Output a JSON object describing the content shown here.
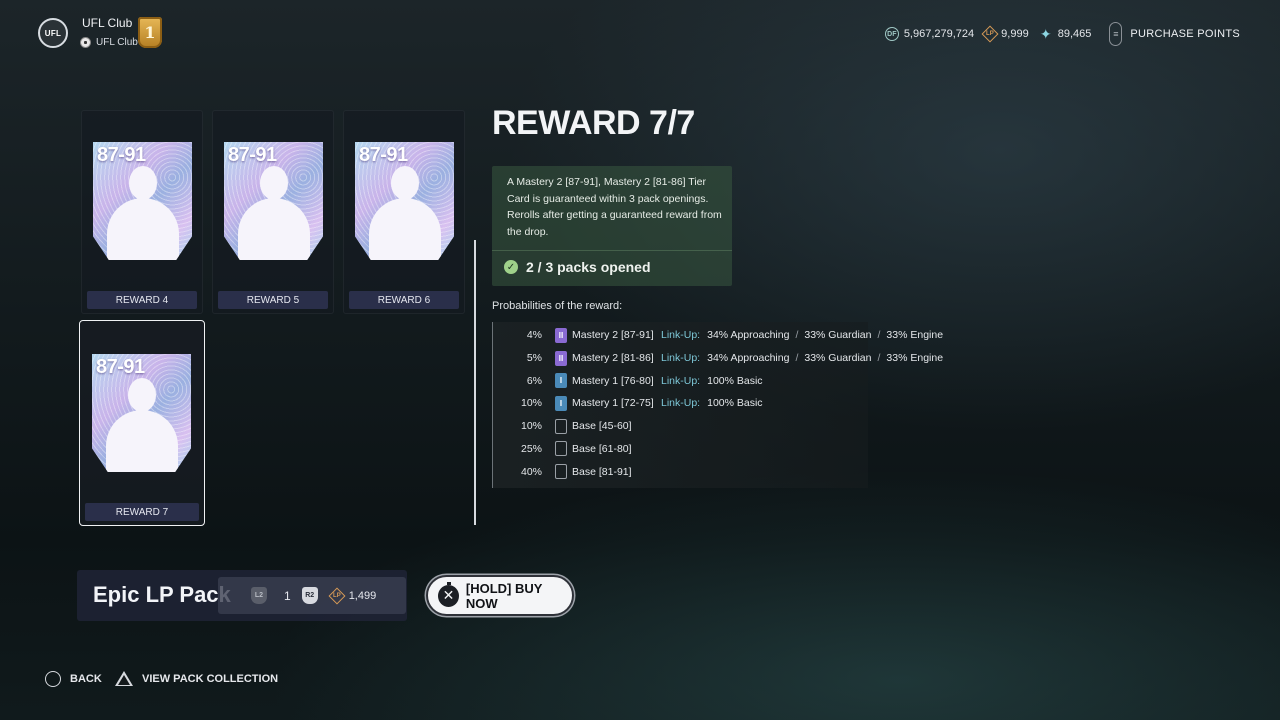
{
  "header": {
    "club_logo_text": "UFL",
    "club_name": "UFL Club",
    "club_sub": "UFL Club",
    "rank": "1",
    "currencies": [
      {
        "icon": "df-coin-icon",
        "label": "DF",
        "value": "5,967,279,724"
      },
      {
        "icon": "lp-diamond-icon",
        "label": "LP",
        "value": "9,999"
      },
      {
        "icon": "sparkle-icon",
        "label": "",
        "value": "89,465"
      }
    ],
    "purchase_points_label": "PURCHASE POINTS"
  },
  "rewards": [
    {
      "rating": "87-91",
      "label": "REWARD 4"
    },
    {
      "rating": "87-91",
      "label": "REWARD 5"
    },
    {
      "rating": "87-91",
      "label": "REWARD 6"
    },
    {
      "rating": "87-91",
      "label": "REWARD 7",
      "selected": true
    }
  ],
  "detail": {
    "title": "REWARD 7/7",
    "description": "A Mastery 2 [87-91], Mastery 2 [81-86] Tier Card is guaranteed within 3 pack openings. Rerolls after getting a guaranteed reward from the drop.",
    "packs_opened": "2 / 3 packs opened",
    "prob_heading": "Probabilities of the reward:",
    "linkup_label": "Link-Up:",
    "probabilities": [
      {
        "pct": "4%",
        "tier": "m2",
        "tier_glyph": "II",
        "name": "Mastery 2 [87-91]",
        "linkups": [
          "34% Approaching",
          "33% Guardian",
          "33% Engine"
        ]
      },
      {
        "pct": "5%",
        "tier": "m2",
        "tier_glyph": "II",
        "name": "Mastery 2 [81-86]",
        "linkups": [
          "34% Approaching",
          "33% Guardian",
          "33% Engine"
        ]
      },
      {
        "pct": "6%",
        "tier": "m1",
        "tier_glyph": "I",
        "name": "Mastery 1 [76-80]",
        "linkups": [
          "100% Basic"
        ]
      },
      {
        "pct": "10%",
        "tier": "m1",
        "tier_glyph": "I",
        "name": "Mastery 1 [72-75]",
        "linkups": [
          "100% Basic"
        ]
      },
      {
        "pct": "10%",
        "tier": "base",
        "tier_glyph": "",
        "name": "Base [45-60]",
        "linkups": []
      },
      {
        "pct": "25%",
        "tier": "base",
        "tier_glyph": "",
        "name": "Base [61-80]",
        "linkups": []
      },
      {
        "pct": "40%",
        "tier": "base",
        "tier_glyph": "",
        "name": "Base [81-91]",
        "linkups": []
      }
    ]
  },
  "pack": {
    "name": "Epic LP Pack",
    "l2_label": "L2",
    "quantity": "1",
    "r2_label": "R2",
    "lp_label": "LP",
    "price": "1,499"
  },
  "buy_button": "[HOLD] BUY NOW",
  "footer": {
    "back": "BACK",
    "view_collection": "VIEW PACK COLLECTION"
  }
}
